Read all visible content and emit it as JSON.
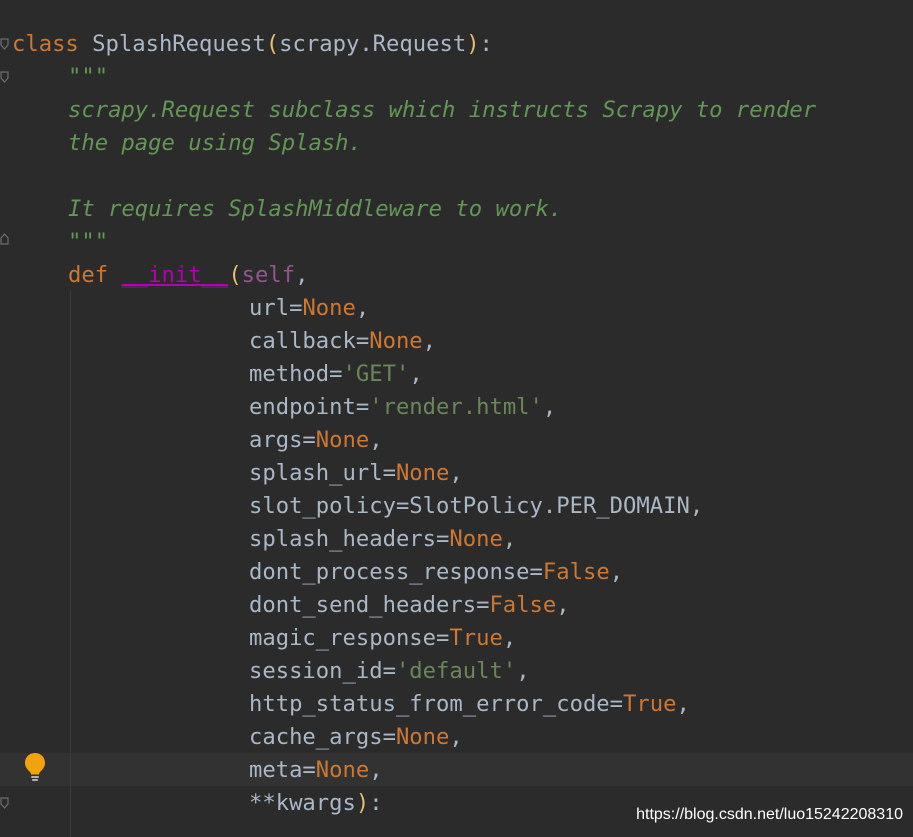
{
  "code": {
    "class_decl": {
      "kw": "class",
      "name": "SplashRequest",
      "open": "(",
      "base": "scrapy.Request",
      "close": ")",
      "colon": ":"
    },
    "doc_open": "\"\"\"",
    "doc_line1": "scrapy.Request subclass which instructs Scrapy to render",
    "doc_line2": "the page using Splash.",
    "doc_line3": "It requires SplashMiddleware to work.",
    "doc_close": "\"\"\"",
    "def_line": {
      "kw": "def",
      "name": "__init__",
      "open": "(",
      "self": "self",
      "comma": ","
    },
    "params": [
      {
        "name": "url=",
        "value": "None",
        "type": "const",
        "tail": ","
      },
      {
        "name": "callback=",
        "value": "None",
        "type": "const",
        "tail": ","
      },
      {
        "name": "method=",
        "value": "'GET'",
        "type": "str",
        "tail": ","
      },
      {
        "name": "endpoint=",
        "value": "'render.html'",
        "type": "str",
        "tail": ","
      },
      {
        "name": "args=",
        "value": "None",
        "type": "const",
        "tail": ","
      },
      {
        "name": "splash_url=",
        "value": "None",
        "type": "const",
        "tail": ","
      },
      {
        "name": "slot_policy=",
        "value": "SlotPolicy.PER_DOMAIN",
        "type": "plain",
        "tail": ","
      },
      {
        "name": "splash_headers=",
        "value": "None",
        "type": "const",
        "tail": ","
      },
      {
        "name": "dont_process_response=",
        "value": "False",
        "type": "const",
        "tail": ","
      },
      {
        "name": "dont_send_headers=",
        "value": "False",
        "type": "const",
        "tail": ","
      },
      {
        "name": "magic_response=",
        "value": "True",
        "type": "const",
        "tail": ","
      },
      {
        "name": "session_id=",
        "value": "'default'",
        "type": "str",
        "tail": ","
      },
      {
        "name": "http_status_from_error_code=",
        "value": "True",
        "type": "const",
        "tail": ","
      },
      {
        "name": "cache_args=",
        "value": "None",
        "type": "const",
        "tail": ","
      },
      {
        "name": "meta=",
        "value": "None",
        "type": "const",
        "tail": ","
      }
    ],
    "kwargs_line": {
      "text": "**kwargs",
      "close": ")",
      "colon": ":"
    }
  },
  "gutter": {
    "intention_icon": "lightbulb-icon"
  },
  "watermark": "https://blog.csdn.net/luo15242208310",
  "colors": {
    "background": "#2b2b2b",
    "keyword": "#cc7832",
    "docstring": "#629755",
    "string": "#6a8759",
    "self": "#94558d",
    "magic": "#b200b2",
    "default_text": "#a9b7c6",
    "bulb": "#f0a30a"
  }
}
